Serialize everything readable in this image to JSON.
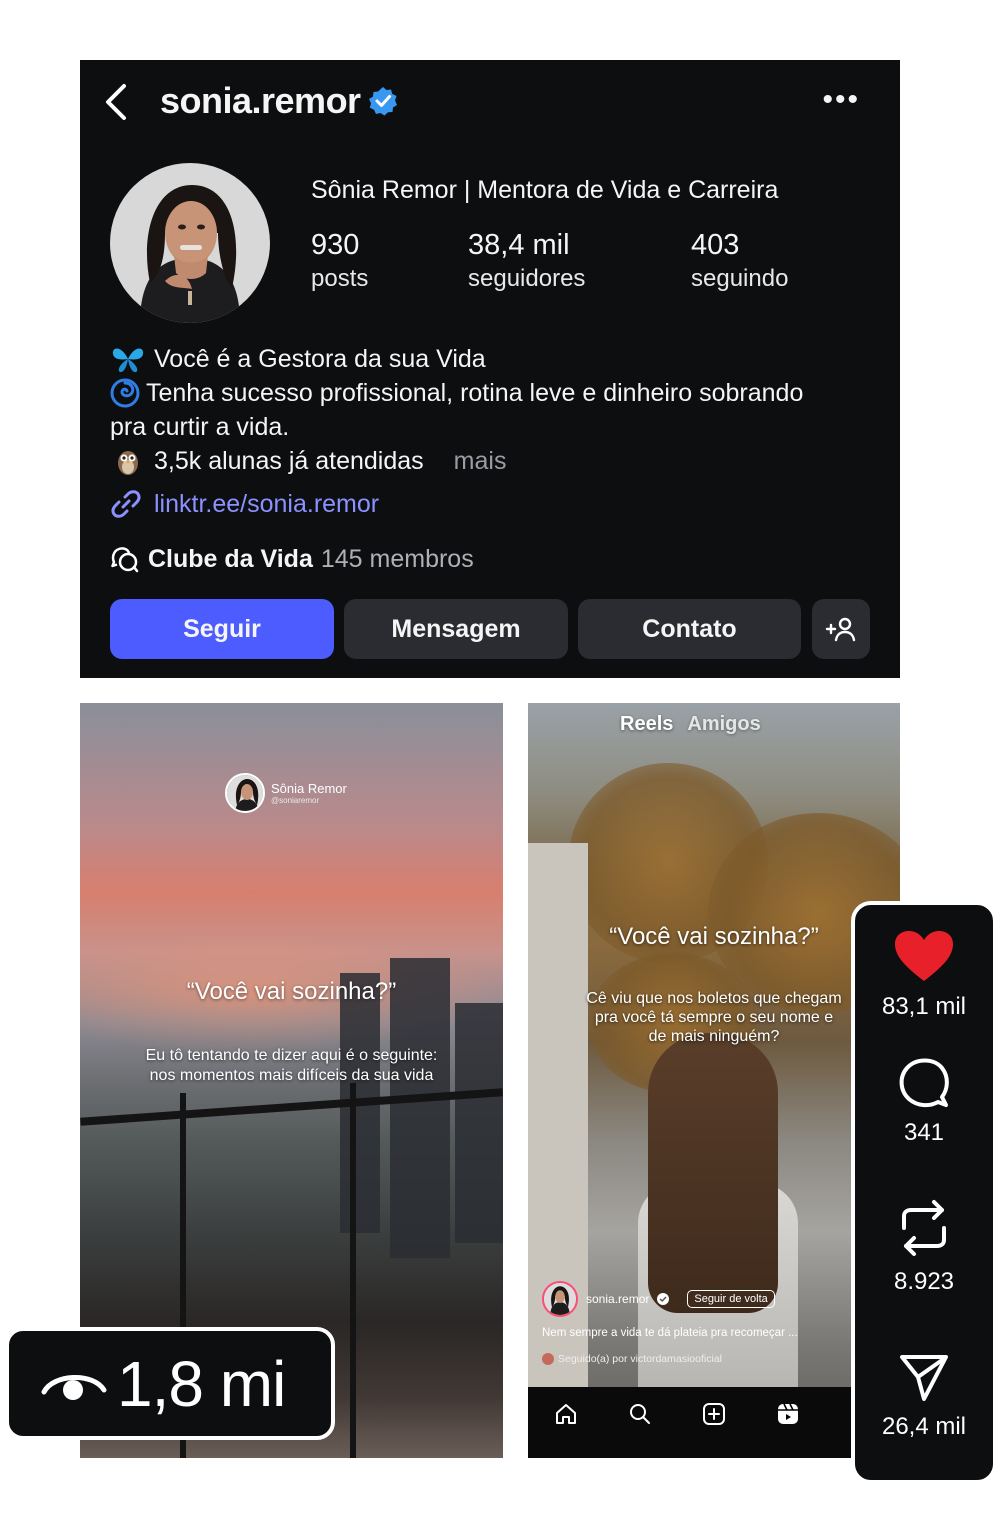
{
  "profile": {
    "username": "sonia.remor",
    "display_name": "Sônia Remor | Mentora de Vida e Carreira",
    "stats": [
      {
        "value": "930",
        "label": "posts"
      },
      {
        "value": "38,4 mil",
        "label": "seguidores"
      },
      {
        "value": "403",
        "label": "seguindo"
      }
    ],
    "bio": {
      "line1": "Você é a Gestora da sua Vida",
      "line2": "Tenha sucesso profissional, rotina leve e dinheiro sobrando",
      "line3": "pra curtir a vida.",
      "line4": "3,5k alunas já atendidas",
      "more": "mais"
    },
    "link": "linktr.ee/sonia.remor",
    "channel": {
      "name": "Clube da Vida",
      "members": "145 membros"
    },
    "buttons": {
      "follow": "Seguir",
      "message": "Mensagem",
      "contact": "Contato",
      "add_user": "+"
    }
  },
  "reel1": {
    "brand_name": "Sônia Remor",
    "brand_handle": "@soniaremor",
    "quote": "“Você vai sozinha?”",
    "subtext": "Eu tô tentando te dizer aqui é o seguinte: nos momentos mais difíceis da sua vida"
  },
  "views": {
    "value": "1,8 mi",
    "icon": "eye-icon"
  },
  "reel2": {
    "tab_reels": "Reels",
    "tab_friends": "Amigos",
    "quote": "“Você vai sozinha?”",
    "subtext": "Cê viu que nos boletos que chegam pra você tá sempre o seu nome e de mais ninguém?",
    "owner": "sonia.remor",
    "follow_back": "Seguir de volta",
    "caption": "Nem sempre a vida te dá plateia pra recomeçar ...",
    "followed_by": "Seguido(a) por victordamasiooficial"
  },
  "actions": {
    "likes": "83,1 mil",
    "comments": "341",
    "reposts": "8.923",
    "shares": "26,4 mil"
  },
  "colors": {
    "panel": "#0d0e10",
    "follow_button": "#4d5cff",
    "dark_button": "#2a2c31",
    "link": "#8b91ff",
    "verified": "#3897f0",
    "heart": "#e8202a"
  }
}
